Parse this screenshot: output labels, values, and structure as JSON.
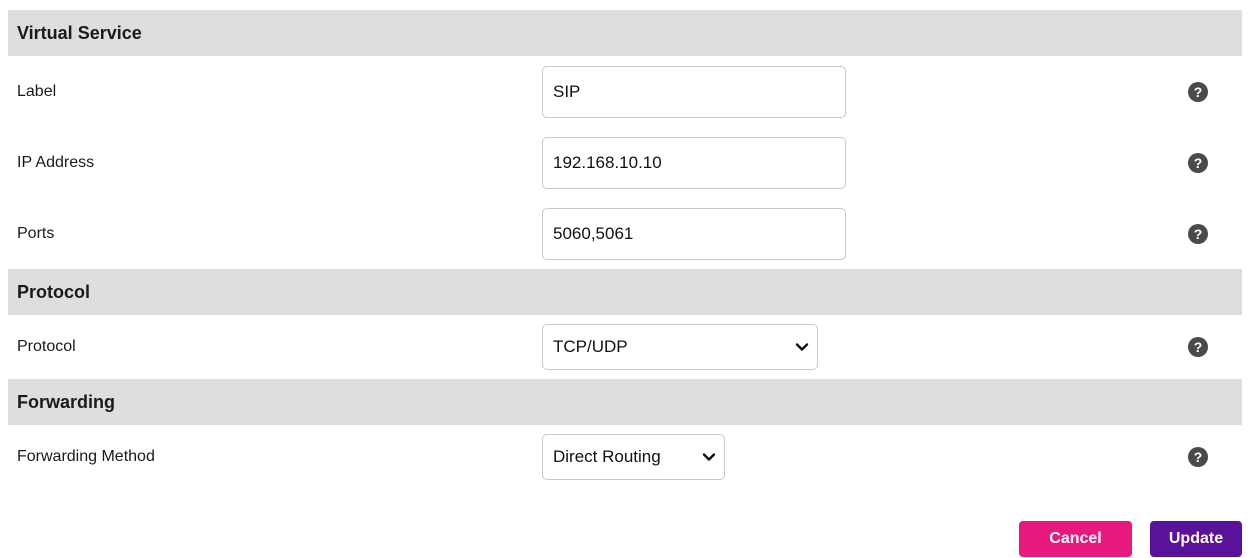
{
  "sections": {
    "virtual_service": {
      "title": "Virtual Service",
      "label": {
        "label": "Label",
        "value": "SIP"
      },
      "ip_address": {
        "label": "IP Address",
        "value": "192.168.10.10"
      },
      "ports": {
        "label": "Ports",
        "value": "5060,5061"
      }
    },
    "protocol": {
      "title": "Protocol",
      "protocol": {
        "label": "Protocol",
        "selected": "TCP/UDP"
      }
    },
    "forwarding": {
      "title": "Forwarding",
      "method": {
        "label": "Forwarding Method",
        "selected": "Direct Routing"
      }
    }
  },
  "icons": {
    "help": "question-mark-circle",
    "dropdown": "chevron-down"
  },
  "help_glyph": "?",
  "buttons": {
    "cancel": "Cancel",
    "update": "Update"
  },
  "colors": {
    "section_header_bg": "#dedede",
    "cancel_button": "#e8197d",
    "update_button": "#5b129a",
    "help_icon": "#4a4a4a"
  }
}
